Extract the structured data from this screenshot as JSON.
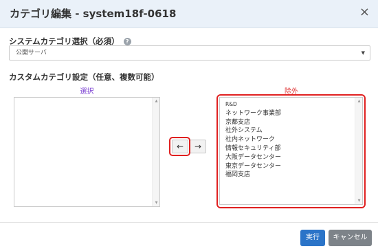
{
  "dialog": {
    "title": "カテゴリ編集 - system18f-0618",
    "close_symbol": "×"
  },
  "system_category": {
    "label": "システムカテゴリ選択（必須）",
    "help_symbol": "?",
    "selected_value": "公開サーバ"
  },
  "custom_category": {
    "label": "カスタムカテゴリ設定（任意、複数可能）",
    "selected_label": "選択",
    "excluded_label": "除外",
    "selected_items": [],
    "excluded_items": [
      "R&D",
      "ネットワーク事業部",
      "京都支店",
      "社外システム",
      "社内ネットワーク",
      "情報セキュリティ部",
      "大阪データセンター",
      "東京データセンター",
      "福岡支店"
    ]
  },
  "move_buttons": {
    "left_symbol": "←",
    "right_symbol": "→"
  },
  "footer": {
    "execute_label": "実行",
    "cancel_label": "キャンセル"
  },
  "colors": {
    "header_bg": "#eaf1f9",
    "selected_label": "#7a3fd1",
    "excluded_label": "#e03a3a",
    "highlight_frame": "#e02020",
    "execute_button": "#2b74c8",
    "cancel_button": "#7d8389"
  }
}
